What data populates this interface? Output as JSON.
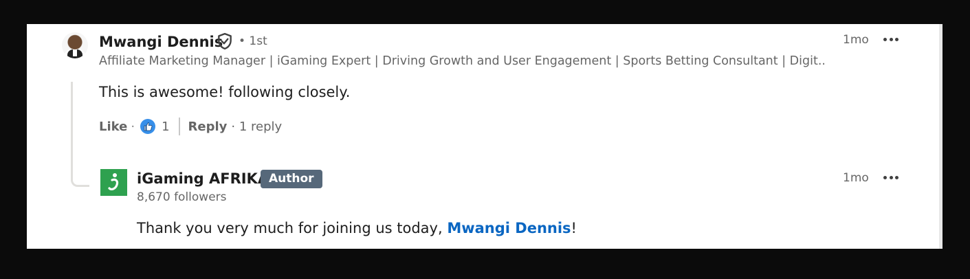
{
  "comment": {
    "author_name": "Mwangi Dennis",
    "degree": "• 1st",
    "headline": "Affiliate Marketing Manager | iGaming Expert | Driving Growth and User Engagement | Sports Betting Consultant | Digit...",
    "timestamp": "1mo",
    "text": "This is awesome! following closely.",
    "actions": {
      "like_label": "Like",
      "dot": "·",
      "reaction_count": "1",
      "reply_label": "Reply",
      "replies_text": "· 1 reply"
    }
  },
  "reply": {
    "author_name": "iGaming AFRIKA",
    "badge": "Author",
    "followers": "8,670 followers",
    "timestamp": "1mo",
    "text_before": "Thank you very much for joining us today, ",
    "mention": "Mwangi Dennis",
    "text_after": "!"
  },
  "icons": {
    "verified": "shield-check-icon",
    "more": "ellipsis-icon",
    "reaction": "thumbs-up-icon",
    "org_logo": "igaming-afrika-logo"
  },
  "colors": {
    "link": "#0a66c2",
    "badge_bg": "#56687a",
    "reaction": "#378fe9",
    "org_logo_bg": "#2ea14f"
  }
}
